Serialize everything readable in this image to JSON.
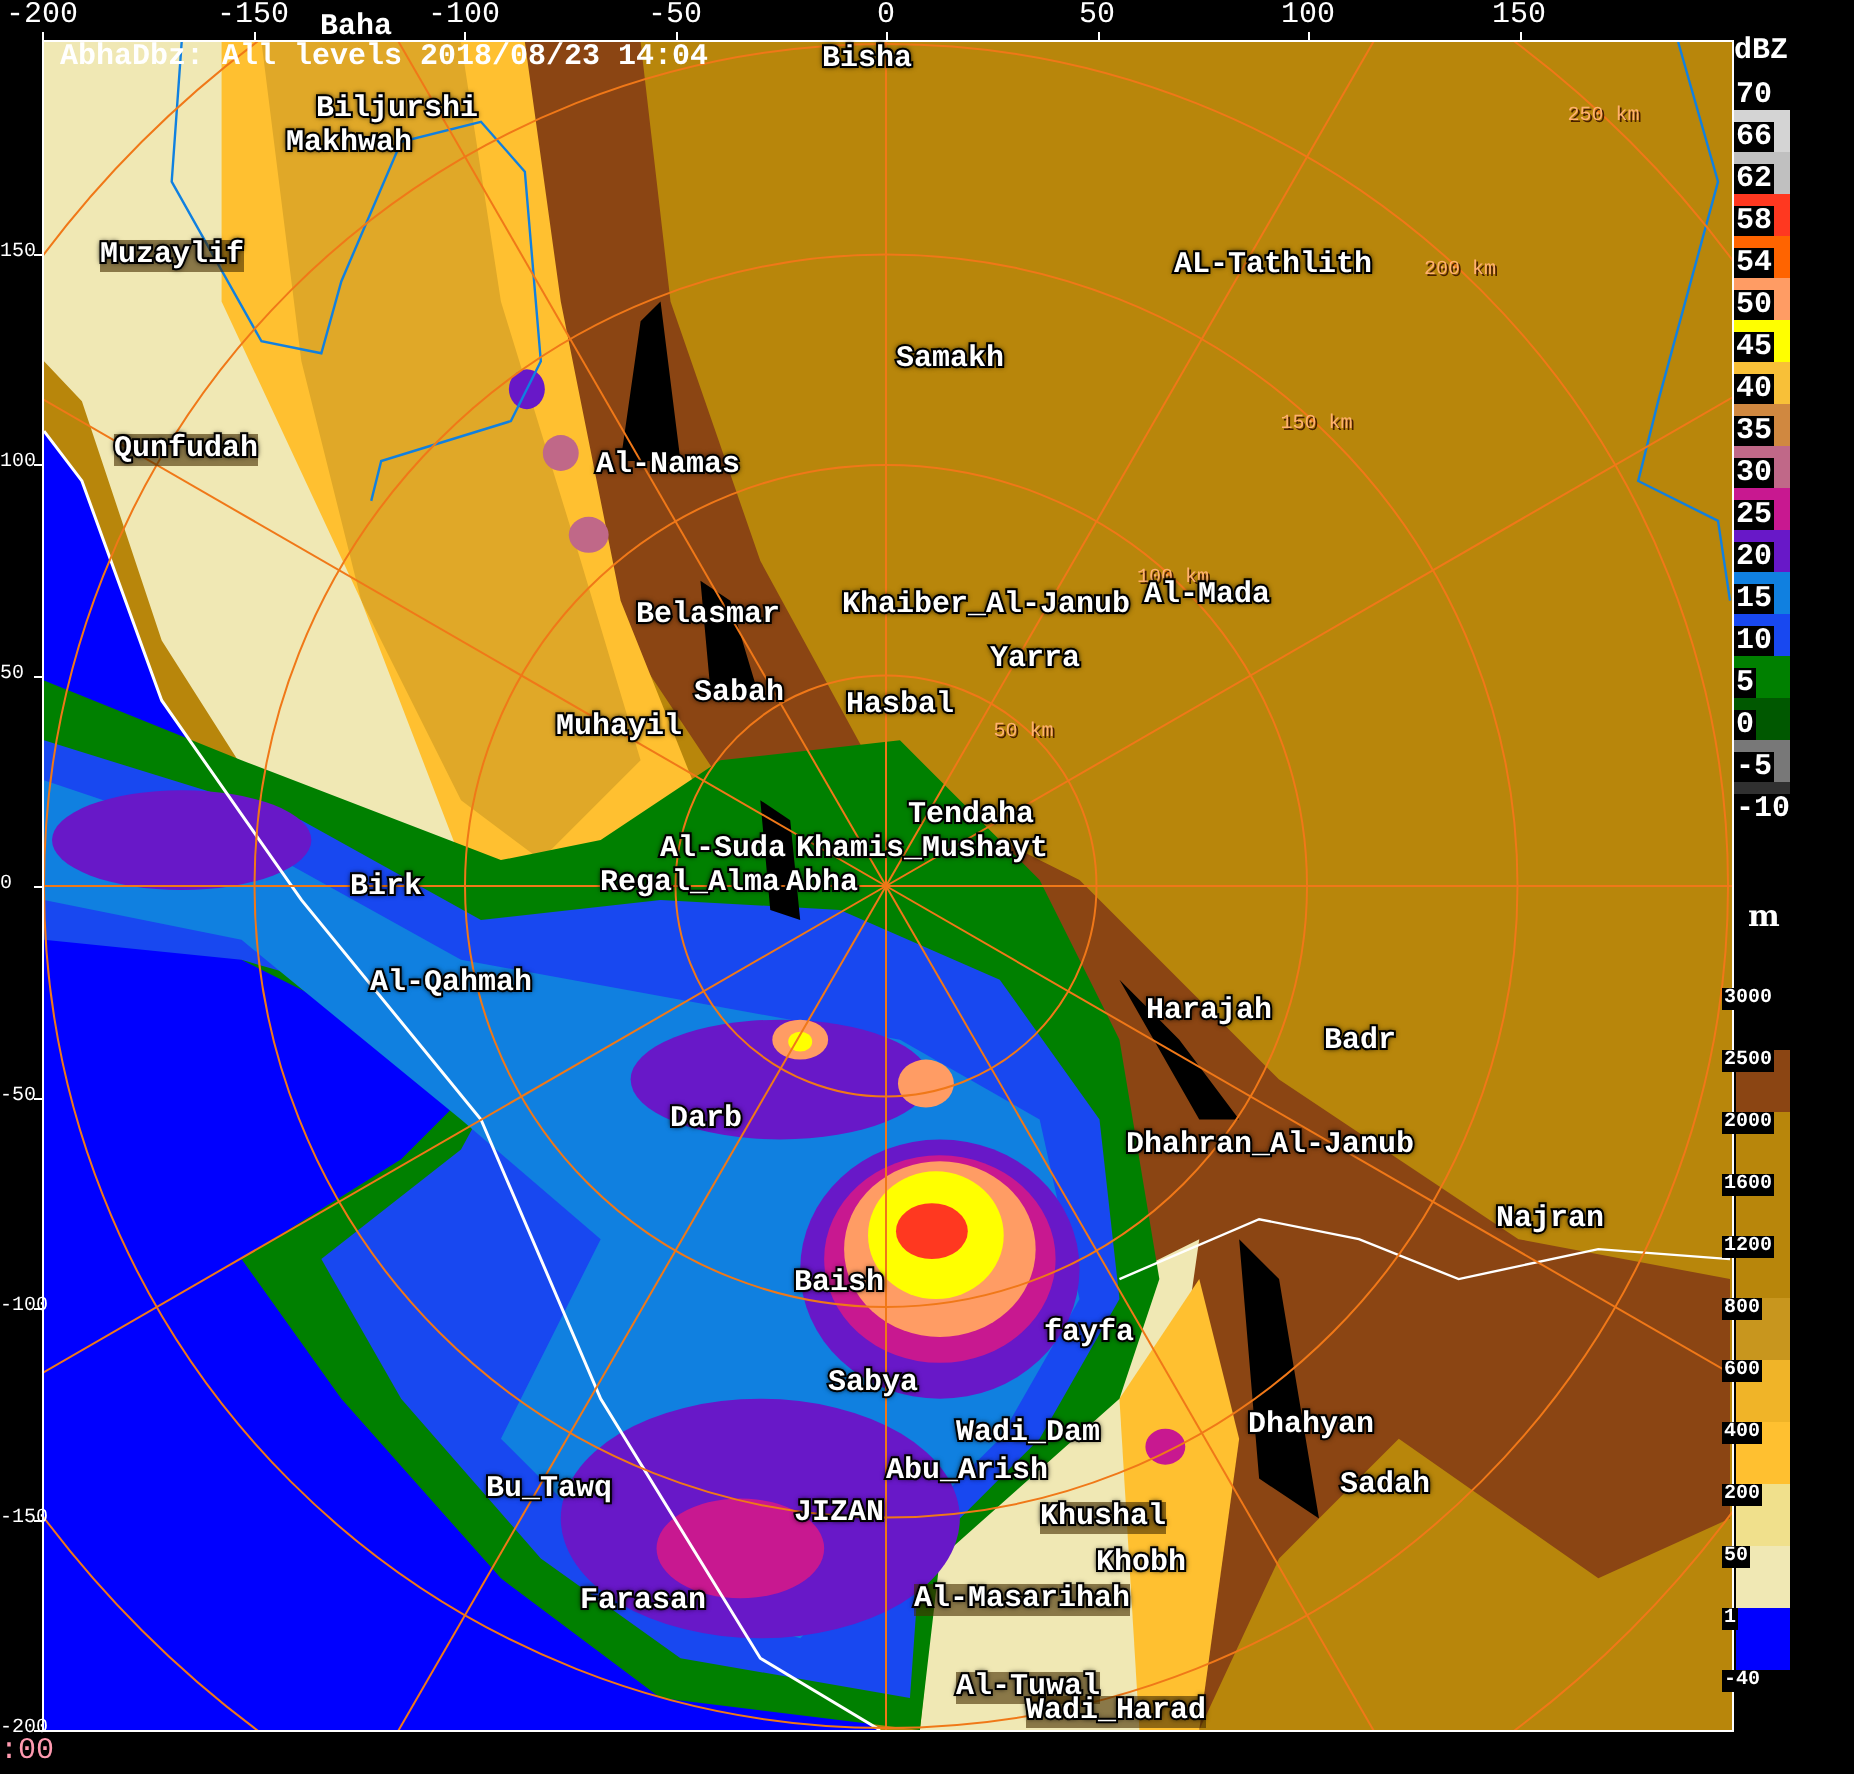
{
  "title": "AbhaDbz: All levels 2018/08/23 14:04",
  "x_ticks": [
    "-200",
    "-150",
    "-100",
    "-50",
    "0",
    "50",
    "100",
    "150"
  ],
  "y_ticks": [
    "150",
    "100",
    "50",
    "0",
    "-50",
    "-100",
    "-150",
    "-200"
  ],
  "range_rings": [
    "50 km",
    "100 km",
    "150 km",
    "200 km",
    "250 km"
  ],
  "places": [
    "Baha",
    "Bisha",
    "Biljurshi",
    "Makhwah",
    "Muzaylif",
    "AL-Tathlith",
    "Samakh",
    "Qunfudah",
    "Al-Namas",
    "Belasmar",
    "Khaiber_Al-Janub",
    "Al-Mada",
    "Yarra",
    "Sabah",
    "Hasbal",
    "Muhayil",
    "Tendaha",
    "Al-Suda",
    "Khamis_Mushayt",
    "Birk",
    "Regal_Alma",
    "Abha",
    "Al-Qahmah",
    "Harajah",
    "Badr",
    "Darb",
    "Dhahran_Al-Janub",
    "Najran",
    "Baish",
    "fayfa",
    "Sabya",
    "Wadi_Dam",
    "Dhahyan",
    "Bu_Tawq",
    "Abu_Arish",
    "Sadah",
    "JIZAN",
    "Khushal",
    "Khobh",
    "Al-Masarihah",
    "Farasan",
    "Al-Tuwal",
    "Wadi_Harad"
  ],
  "reflectivity_legend": {
    "unit": "dBZ",
    "levels": [
      {
        "label": "70"
      },
      {
        "label": "66",
        "color": "#d4d4d4"
      },
      {
        "label": "62",
        "color": "#c0c0c0"
      },
      {
        "label": "58",
        "color": "#ff3820"
      },
      {
        "label": "54",
        "color": "#ff6400"
      },
      {
        "label": "50",
        "color": "#ff9c64"
      },
      {
        "label": "45",
        "color": "#ffff00"
      },
      {
        "label": "40",
        "color": "#f8c038"
      },
      {
        "label": "35",
        "color": "#d08840"
      },
      {
        "label": "30",
        "color": "#c06888"
      },
      {
        "label": "25",
        "color": "#c81890"
      },
      {
        "label": "20",
        "color": "#6818c8"
      },
      {
        "label": "15",
        "color": "#1080e0"
      },
      {
        "label": "10",
        "color": "#1848f0"
      },
      {
        "label": "5",
        "color": "#008000"
      },
      {
        "label": "0",
        "color": "#005800"
      },
      {
        "label": "-5",
        "color": "#787878"
      },
      {
        "label": "-10",
        "color": "#303030"
      }
    ]
  },
  "height_legend": {
    "unit": "m",
    "levels": [
      {
        "label": "3000"
      },
      {
        "label": "2500",
        "color": "#8b4513"
      },
      {
        "label": "2000",
        "color": "#b8860b"
      },
      {
        "label": "1600",
        "color": "#b8860b"
      },
      {
        "label": "1200",
        "color": "#b8860b"
      },
      {
        "label": "800",
        "color": "#c8961e"
      },
      {
        "label": "600",
        "color": "#f0b428"
      },
      {
        "label": "400",
        "color": "#ffc030"
      },
      {
        "label": "200",
        "color": "#f0e08c"
      },
      {
        "label": "50",
        "color": "#f0e8b4"
      },
      {
        "label": "1",
        "color": "#0000ff"
      },
      {
        "label": "-40"
      }
    ]
  },
  "footer": ":00"
}
